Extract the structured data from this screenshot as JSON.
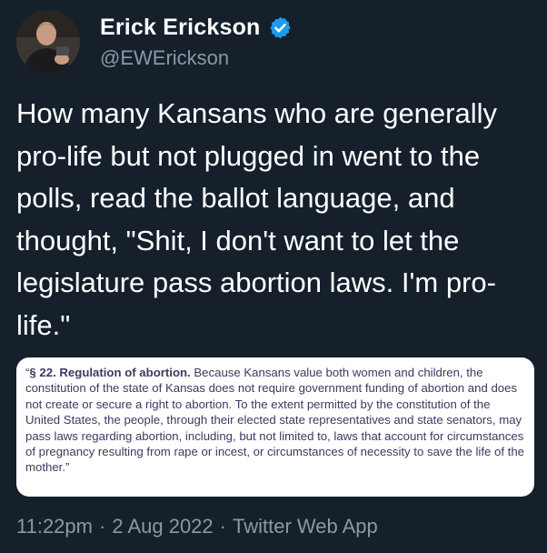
{
  "author": {
    "display_name": "Erick Erickson",
    "handle": "@EWErickson",
    "verified_icon": "verified-badge-icon",
    "verified_color": "#1d9bf0"
  },
  "tweet": {
    "text": "How many Kansans who are generally pro-life but not plugged in went to the polls, read the ballot language, and thought, \"Shit, I don't want to let the legislature pass abortion laws.  I'm pro-life.\""
  },
  "media": {
    "quote_open": "“",
    "heading": "§ 22. Regulation of abortion.",
    "body": "Because Kansans value both women and children, the constitution of the state of Kansas does not require government funding of abortion and does not create or secure a right to abortion. To the extent permitted by the constitution of the United States, the people, through their elected state representatives and state senators, may pass laws regarding abortion, including, but not limited to, laws that account for circumstances of pregnancy resulting from rape or incest, or circumstances of necessity to save the life of the mother.”"
  },
  "meta": {
    "time": "11:22pm",
    "date": "2 Aug 2022",
    "source": "Twitter Web App",
    "separator": "·"
  },
  "colors": {
    "background": "#15202b",
    "text": "#ffffff",
    "secondary_text": "#8b98a5",
    "statute_text": "#3a3a64"
  }
}
